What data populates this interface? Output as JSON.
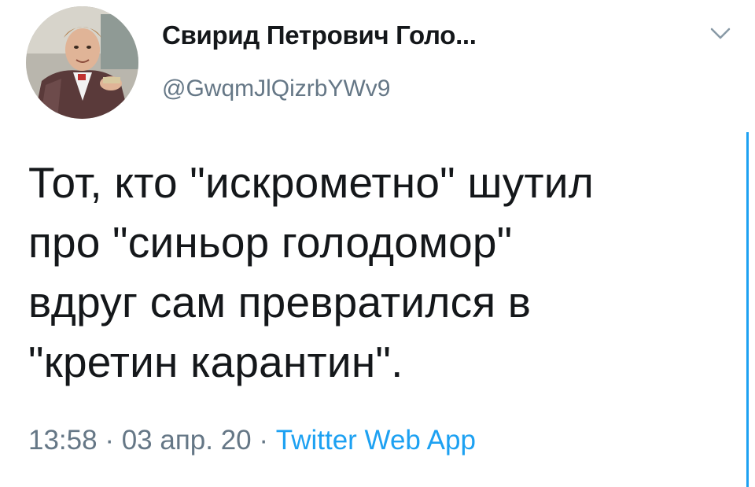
{
  "tweet": {
    "author": {
      "display_name": "Свирид Петрович Голо...",
      "handle": "@GwqmJlQizrbYWv9",
      "avatar_icon": "user-avatar"
    },
    "menu_icon": "chevron-down-icon",
    "text": "Тот, кто \"искрометно\" шутил\nпро \"синьор голодомор\"\nвдруг сам превратился в\n\"кретин карантин\".",
    "time": "13:58",
    "separator": "·",
    "date": "03 апр. 20",
    "source": "Twitter Web App"
  },
  "colors": {
    "text": "#14171a",
    "secondary": "#657786",
    "accent": "#1da1f2"
  }
}
